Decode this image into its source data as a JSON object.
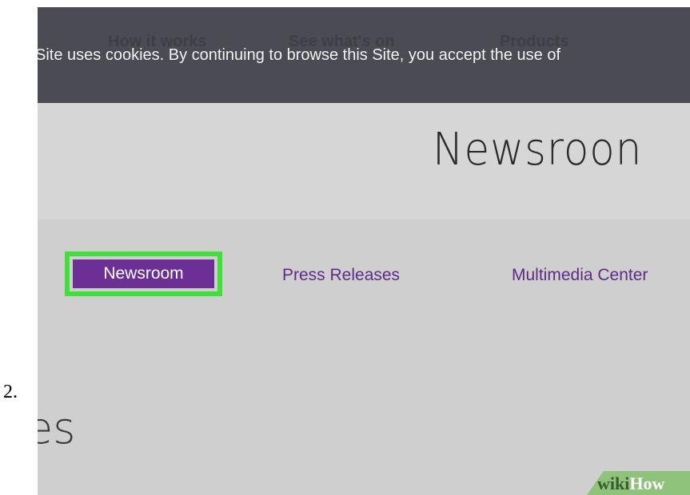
{
  "step": {
    "number": "2."
  },
  "top_bar": {
    "behind_nav": [
      "How it works",
      "See what's on",
      "Products"
    ],
    "cookie_notice": "Site uses cookies. By continuing to browse this Site, you accept the use of"
  },
  "hero": {
    "title": "Newsroon"
  },
  "subnav": {
    "active": "Newsroom",
    "links": [
      "Press Releases",
      "Multimedia Center"
    ]
  },
  "page": {
    "partial_heading": "es"
  },
  "watermark": {
    "part1": "wiki",
    "part2": "How"
  },
  "colors": {
    "top_bar": "#4a4b53",
    "accent_purple": "#6c2f96",
    "link_purple": "#5f2b86",
    "highlight_green": "#3fe03a",
    "page_gray": "#cfcfcf"
  }
}
